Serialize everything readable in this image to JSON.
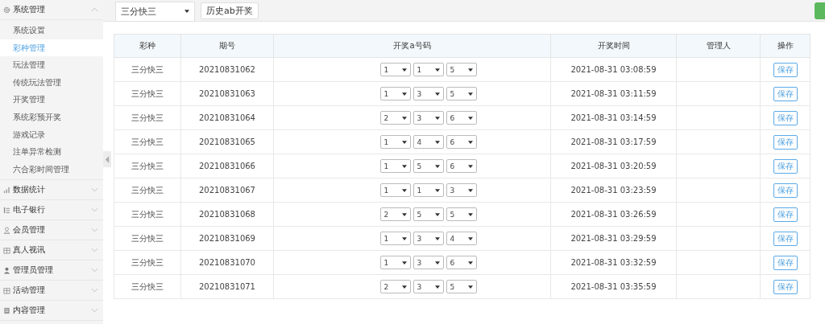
{
  "sidebar": {
    "groups": [
      {
        "label": "系统管理",
        "expanded": true,
        "items": [
          {
            "label": "系统设置",
            "selected": false
          },
          {
            "label": "彩种管理",
            "selected": true
          },
          {
            "label": "玩法管理",
            "selected": false
          },
          {
            "label": "传统玩法管理",
            "selected": false
          },
          {
            "label": "开奖管理",
            "selected": false
          },
          {
            "label": "系统彩预开奖",
            "selected": false
          },
          {
            "label": "游戏记录",
            "selected": false
          },
          {
            "label": "注单异常检测",
            "selected": false
          },
          {
            "label": "六合彩时间管理",
            "selected": false
          }
        ]
      },
      {
        "label": "数据统计",
        "expanded": false
      },
      {
        "label": "电子银行",
        "expanded": false
      },
      {
        "label": "会员管理",
        "expanded": false
      },
      {
        "label": "真人视讯",
        "expanded": false
      },
      {
        "label": "管理员管理",
        "expanded": false
      },
      {
        "label": "活动管理",
        "expanded": false
      },
      {
        "label": "内容管理",
        "expanded": false
      }
    ]
  },
  "toolbar": {
    "lottery_select": "三分快三",
    "history_button": "历史ab开奖"
  },
  "table": {
    "columns": [
      "彩种",
      "期号",
      "开奖a号码",
      "开奖时间",
      "管理人",
      "操作"
    ],
    "rows": [
      {
        "lottery": "三分快三",
        "issue": "20210831062",
        "numbers": [
          "1",
          "1",
          "5"
        ],
        "time": "2021-08-31 03:08:59",
        "action": "保存"
      },
      {
        "lottery": "三分快三",
        "issue": "20210831063",
        "numbers": [
          "1",
          "3",
          "5"
        ],
        "time": "2021-08-31 03:11:59",
        "action": "保存"
      },
      {
        "lottery": "三分快三",
        "issue": "20210831064",
        "numbers": [
          "2",
          "3",
          "6"
        ],
        "time": "2021-08-31 03:14:59",
        "action": "保存"
      },
      {
        "lottery": "三分快三",
        "issue": "20210831065",
        "numbers": [
          "1",
          "4",
          "6"
        ],
        "time": "2021-08-31 03:17:59",
        "action": "保存"
      },
      {
        "lottery": "三分快三",
        "issue": "20210831066",
        "numbers": [
          "1",
          "5",
          "6"
        ],
        "time": "2021-08-31 03:20:59",
        "action": "保存"
      },
      {
        "lottery": "三分快三",
        "issue": "20210831067",
        "numbers": [
          "1",
          "1",
          "3"
        ],
        "time": "2021-08-31 03:23:59",
        "action": "保存"
      },
      {
        "lottery": "三分快三",
        "issue": "20210831068",
        "numbers": [
          "2",
          "5",
          "5"
        ],
        "time": "2021-08-31 03:26:59",
        "action": "保存"
      },
      {
        "lottery": "三分快三",
        "issue": "20210831069",
        "numbers": [
          "1",
          "3",
          "4"
        ],
        "time": "2021-08-31 03:29:59",
        "action": "保存"
      },
      {
        "lottery": "三分快三",
        "issue": "20210831070",
        "numbers": [
          "1",
          "3",
          "6"
        ],
        "time": "2021-08-31 03:32:59",
        "action": "保存"
      },
      {
        "lottery": "三分快三",
        "issue": "20210831071",
        "numbers": [
          "2",
          "3",
          "5"
        ],
        "time": "2021-08-31 03:35:59",
        "action": "保存"
      }
    ]
  }
}
